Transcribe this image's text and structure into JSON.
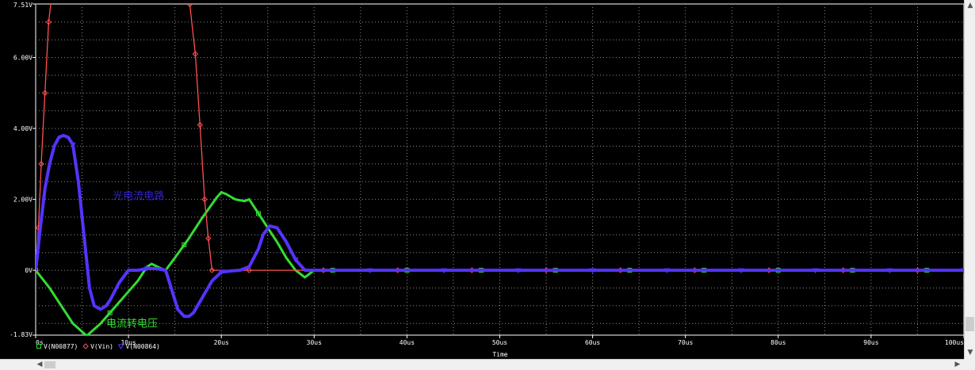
{
  "chart_data": {
    "type": "line",
    "x_unit": "us",
    "xlim": [
      0,
      100
    ],
    "ylim": [
      -1.83,
      7.51
    ],
    "y_unit": "V",
    "xlabel": "Time",
    "ylabel": "",
    "grid": true,
    "background": "#000000",
    "grid_color": "#8c8c8c",
    "x_ticks": [
      {
        "v": 0,
        "label": "0s"
      },
      {
        "v": 10,
        "label": "10us"
      },
      {
        "v": 20,
        "label": "20us"
      },
      {
        "v": 30,
        "label": "30us"
      },
      {
        "v": 40,
        "label": "40us"
      },
      {
        "v": 50,
        "label": "50us"
      },
      {
        "v": 60,
        "label": "60us"
      },
      {
        "v": 70,
        "label": "70us"
      },
      {
        "v": 80,
        "label": "80us"
      },
      {
        "v": 90,
        "label": "90us"
      },
      {
        "v": 100,
        "label": "100us"
      }
    ],
    "y_ticks": [
      {
        "v": -1.83,
        "label": "-1.83V"
      },
      {
        "v": 0,
        "label": "0V"
      },
      {
        "v": 2,
        "label": "2.00V"
      },
      {
        "v": 4,
        "label": "4.00V"
      },
      {
        "v": 6,
        "label": "6.00V"
      },
      {
        "v": 7.51,
        "label": "7.51V"
      }
    ],
    "legend_position": "bottom-left",
    "series": [
      {
        "name": "V(N00877)",
        "color": "#33dd33",
        "width": 3,
        "marker": "square",
        "points": [
          [
            0,
            0
          ],
          [
            1.5,
            -0.5
          ],
          [
            3,
            -1.1
          ],
          [
            4,
            -1.5
          ],
          [
            5.5,
            -1.85
          ],
          [
            7,
            -1.5
          ],
          [
            8.5,
            -1.05
          ],
          [
            10,
            -0.6
          ],
          [
            11,
            -0.3
          ],
          [
            12,
            0.1
          ],
          [
            12.5,
            0.18
          ],
          [
            13.5,
            0.05
          ],
          [
            14,
            0
          ],
          [
            15,
            0.35
          ],
          [
            16.5,
            0.9
          ],
          [
            18,
            1.5
          ],
          [
            19.5,
            2.05
          ],
          [
            20,
            2.2
          ],
          [
            20.5,
            2.15
          ],
          [
            21.5,
            2.0
          ],
          [
            22.5,
            1.95
          ],
          [
            23,
            2.0
          ],
          [
            24,
            1.6
          ],
          [
            25,
            1.2
          ],
          [
            26,
            0.8
          ],
          [
            27,
            0.35
          ],
          [
            28,
            0
          ],
          [
            29,
            -0.2
          ],
          [
            30,
            0
          ],
          [
            31,
            0
          ],
          [
            100,
            0
          ]
        ]
      },
      {
        "name": "V(Vin)",
        "color": "#ff5050",
        "width": 1.3,
        "marker": "diamond",
        "points": [
          [
            0,
            0
          ],
          [
            0.3,
            1.2
          ],
          [
            0.6,
            3.0
          ],
          [
            1.0,
            5.0
          ],
          [
            1.4,
            7.0
          ],
          [
            1.8,
            7.9
          ],
          [
            2,
            7.9
          ],
          [
            16,
            7.9
          ],
          [
            16.6,
            7.5
          ],
          [
            17.2,
            6.1
          ],
          [
            17.7,
            4.1
          ],
          [
            18.2,
            2.0
          ],
          [
            18.6,
            0.9
          ],
          [
            19,
            0
          ],
          [
            100,
            0
          ]
        ]
      },
      {
        "name": "V(N00864)",
        "color": "#5533ff",
        "width": 4,
        "marker": "triangle",
        "points": [
          [
            0,
            0
          ],
          [
            0.5,
            1.2
          ],
          [
            1,
            2.3
          ],
          [
            1.5,
            3.0
          ],
          [
            2,
            3.5
          ],
          [
            2.5,
            3.75
          ],
          [
            3,
            3.8
          ],
          [
            3.5,
            3.75
          ],
          [
            4,
            3.55
          ],
          [
            4.6,
            2.5
          ],
          [
            5.2,
            1.0
          ],
          [
            5.8,
            -0.5
          ],
          [
            6.3,
            -1.0
          ],
          [
            7,
            -1.1
          ],
          [
            7.6,
            -1.0
          ],
          [
            8,
            -0.85
          ],
          [
            9,
            -0.35
          ],
          [
            10,
            0
          ],
          [
            11,
            0
          ],
          [
            12,
            0.05
          ],
          [
            13,
            0.05
          ],
          [
            14,
            0
          ],
          [
            14.6,
            -0.5
          ],
          [
            15.3,
            -1.1
          ],
          [
            16,
            -1.3
          ],
          [
            16.5,
            -1.3
          ],
          [
            17,
            -1.2
          ],
          [
            18,
            -0.75
          ],
          [
            19,
            -0.3
          ],
          [
            20,
            -0.05
          ],
          [
            21,
            -0.02
          ],
          [
            22,
            0
          ],
          [
            23,
            0.1
          ],
          [
            24,
            0.6
          ],
          [
            24.5,
            1.0
          ],
          [
            25.2,
            1.25
          ],
          [
            26,
            1.2
          ],
          [
            27,
            0.8
          ],
          [
            28,
            0.3
          ],
          [
            29,
            0
          ],
          [
            100,
            0
          ]
        ]
      }
    ],
    "annotations": [
      {
        "text": "电流转电压",
        "x": 7.6,
        "y": -1.6,
        "color": "#33dd33"
      },
      {
        "text": "光电流电路",
        "x": 8.3,
        "y": 2.0,
        "color": "#3322cc"
      }
    ]
  }
}
